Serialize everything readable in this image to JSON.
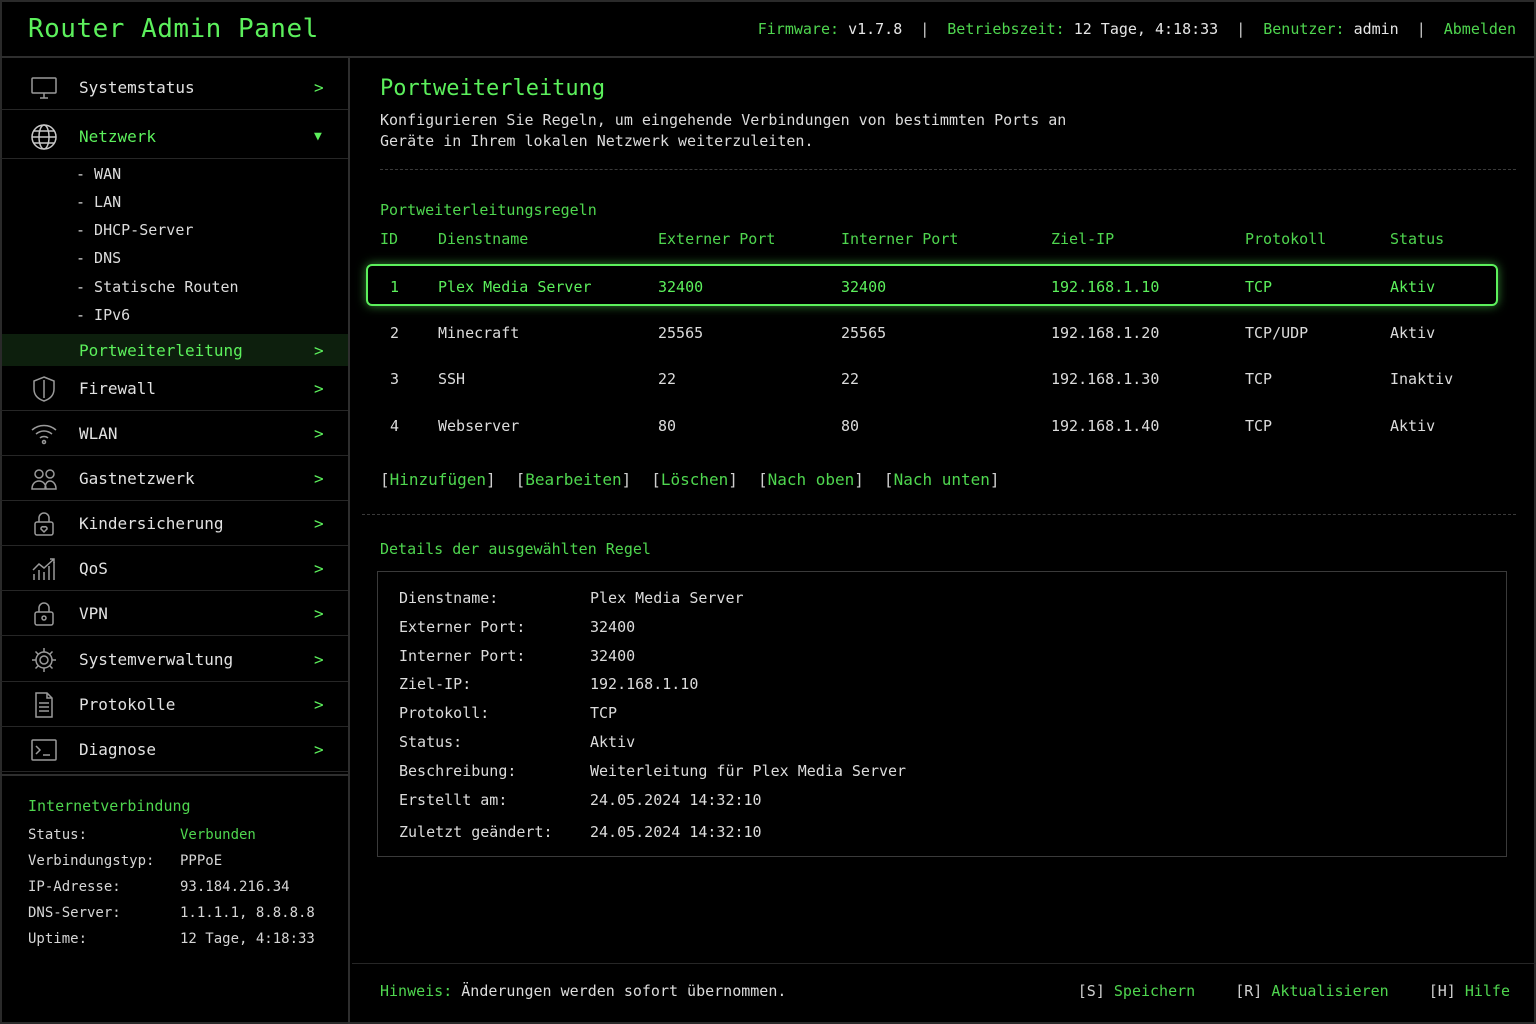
{
  "header": {
    "title": "Router Admin Panel",
    "firmware_label": "Firmware:",
    "firmware_value": "v1.7.8",
    "uptime_label": "Betriebszeit:",
    "uptime_value": "12 Tage, 4:18:33",
    "user_label": "Benutzer:",
    "user_value": "admin",
    "logout": "Abmelden"
  },
  "sidebar": {
    "items": [
      {
        "label": "Systemstatus",
        "icon": "monitor-icon",
        "chevron": ">"
      },
      {
        "label": "Netzwerk",
        "icon": "globe-icon",
        "chevron": "▼"
      },
      {
        "label": "Firewall",
        "icon": "shield-icon",
        "chevron": ">"
      },
      {
        "label": "WLAN",
        "icon": "wifi-icon",
        "chevron": ">"
      },
      {
        "label": "Gastnetzwerk",
        "icon": "users-icon",
        "chevron": ">"
      },
      {
        "label": "Kindersicherung",
        "icon": "lock-heart-icon",
        "chevron": ">"
      },
      {
        "label": "QoS",
        "icon": "chart-icon",
        "chevron": ">"
      },
      {
        "label": "VPN",
        "icon": "lock-icon",
        "chevron": ">"
      },
      {
        "label": "Systemverwaltung",
        "icon": "gear-icon",
        "chevron": ">"
      },
      {
        "label": "Protokolle",
        "icon": "document-icon",
        "chevron": ">"
      },
      {
        "label": "Diagnose",
        "icon": "terminal-icon",
        "chevron": ">"
      }
    ],
    "network_sub": [
      "-  WAN",
      "-  LAN",
      "-  DHCP-Server",
      "-  DNS",
      "-  Statische Routen",
      "-  IPv6"
    ],
    "active": {
      "label": "Portweiterleitung",
      "chevron": ">"
    },
    "connection": {
      "title": "Internetverbindung",
      "rows": [
        {
          "key": "Status:",
          "value": "Verbunden"
        },
        {
          "key": "Verbindungstyp:",
          "value": "PPPoE"
        },
        {
          "key": "IP-Adresse:",
          "value": "93.184.216.34"
        },
        {
          "key": "DNS-Server:",
          "value": "1.1.1.1, 8.8.8.8"
        },
        {
          "key": "Uptime:",
          "value": "12 Tage, 4:18:33"
        }
      ]
    }
  },
  "main": {
    "title": "Portweiterleitung",
    "description": "Konfigurieren Sie Regeln, um eingehende Verbindungen von bestimmten Ports an Geräte in Ihrem lokalen Netzwerk weiterzuleiten.",
    "rules_label": "Portweiterleitungsregeln",
    "columns": [
      "ID",
      "Dienstname",
      "Externer Port",
      "Interner Port",
      "Ziel-IP",
      "Protokoll",
      "Status"
    ],
    "rows": [
      [
        "1",
        "Plex Media Server",
        "32400",
        "32400",
        "192.168.1.10",
        "TCP",
        "Aktiv"
      ],
      [
        "2",
        "Minecraft",
        "25565",
        "25565",
        "192.168.1.20",
        "TCP/UDP",
        "Aktiv"
      ],
      [
        "3",
        "SSH",
        "22",
        "22",
        "192.168.1.30",
        "TCP",
        "Inaktiv"
      ],
      [
        "4",
        "Webserver",
        "80",
        "80",
        "192.168.1.40",
        "TCP",
        "Aktiv"
      ]
    ],
    "actions": [
      "Hinzufügen",
      "Bearbeiten",
      "Löschen",
      "Nach oben",
      "Nach unten"
    ],
    "details_label": "Details der ausgewählten Regel",
    "details": [
      {
        "key": "Dienstname:",
        "value": "Plex Media Server"
      },
      {
        "key": "Externer Port:",
        "value": "32400"
      },
      {
        "key": "Interner Port:",
        "value": "32400"
      },
      {
        "key": "Ziel-IP:",
        "value": "192.168.1.10"
      },
      {
        "key": "Protokoll:",
        "value": "TCP"
      },
      {
        "key": "Status:",
        "value": "Aktiv"
      },
      {
        "key": "Beschreibung:",
        "value": "Weiterleitung für Plex Media Server"
      },
      {
        "key": "Erstellt am:",
        "value": "24.05.2024 14:32:10"
      },
      {
        "key": "Zuletzt geändert:",
        "value": "24.05.2024 14:32:10"
      }
    ]
  },
  "footer": {
    "hint_label": "Hinweis:",
    "hint_text": "Änderungen werden sofort übernommen.",
    "keys": [
      {
        "key": "[S]",
        "action": "Speichern"
      },
      {
        "key": "[R]",
        "action": "Aktualisieren"
      },
      {
        "key": "[H]",
        "action": "Hilfe"
      }
    ]
  },
  "colors": {
    "accent": "#5cf05c",
    "background": "#000000",
    "text": "#dcdcdc"
  }
}
